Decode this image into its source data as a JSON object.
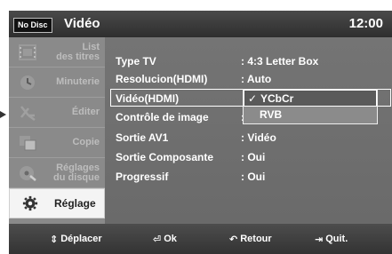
{
  "header": {
    "disc_status": "No Disc",
    "title": "Vidéo",
    "clock": "12:00"
  },
  "sidebar": {
    "items": [
      {
        "label_line1": "List",
        "label_line2": "des titres",
        "icon": "film-icon",
        "active": false
      },
      {
        "label_line1": "Minuterie",
        "label_line2": "",
        "icon": "timer-icon",
        "active": false
      },
      {
        "label_line1": "Éditer",
        "label_line2": "",
        "icon": "scissors-icon",
        "active": false
      },
      {
        "label_line1": "Copie",
        "label_line2": "",
        "icon": "copy-icon",
        "active": false
      },
      {
        "label_line1": "Réglages",
        "label_line2": "du disque",
        "icon": "disc-settings-icon",
        "active": false
      },
      {
        "label_line1": "Réglage",
        "label_line2": "",
        "icon": "gear-icon",
        "active": true
      }
    ]
  },
  "settings": {
    "rows": [
      {
        "label": "Type TV",
        "value": ": 4:3 Letter Box"
      },
      {
        "label": "Resolucion(HDMI)",
        "value": ": Auto"
      },
      {
        "label": "Vidéo(HDMI)",
        "value": ":"
      },
      {
        "label": "Contrôle de image",
        "value": ":"
      },
      {
        "label": "Sortie AV1",
        "value": ": Vidéo"
      },
      {
        "label": "Sortie Composante",
        "value": ": Oui"
      },
      {
        "label": "Progressif",
        "value": ": Oui"
      }
    ]
  },
  "dropdown": {
    "options": [
      {
        "label": "YCbCr",
        "checked": true
      },
      {
        "label": "RVB",
        "checked": false
      }
    ]
  },
  "footer": {
    "hints": [
      {
        "icon": "up-down-arrows-icon",
        "label": "Déplacer"
      },
      {
        "icon": "enter-icon",
        "label": "Ok"
      },
      {
        "icon": "return-icon",
        "label": "Retour"
      },
      {
        "icon": "exit-icon",
        "label": "Quit."
      }
    ]
  }
}
